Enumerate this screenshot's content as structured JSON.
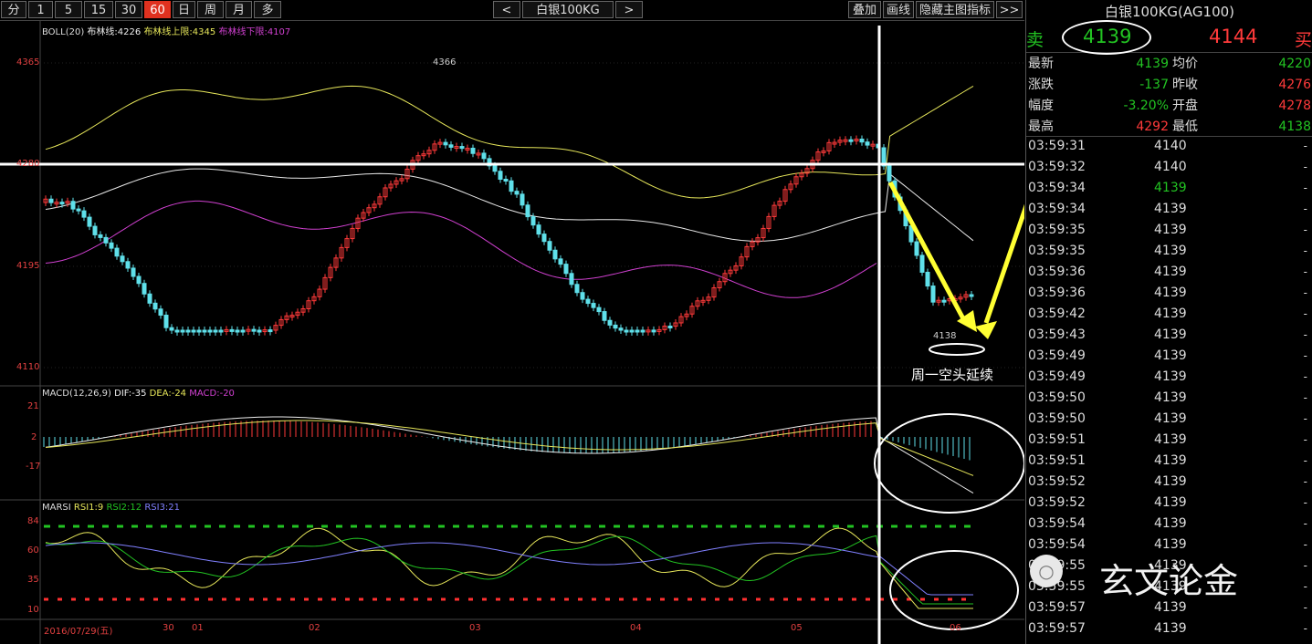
{
  "toolbar": {
    "periods": [
      "分",
      "1",
      "5",
      "15",
      "30",
      "60",
      "日",
      "周",
      "月",
      "多"
    ],
    "active_period": "60",
    "prev_label": "<",
    "next_label": ">",
    "symbol_label": "白银100KG",
    "overlay_label": "叠加",
    "draw_label": "画线",
    "hide_indicator_label": "隐藏主图指标",
    "expand_label": ">>"
  },
  "main_chart": {
    "boll_title": "BOLL(20)",
    "mid_label": "布林线:4226",
    "upper_label": "布林线上限:4345",
    "lower_label": "布林线下限:4107",
    "y_ticks": [
      "4365",
      "4280",
      "4195",
      "4110"
    ],
    "high_mark": "4366",
    "low_mark": "4138",
    "annotation": "周一空头延续"
  },
  "macd": {
    "title": "MACD(12,26,9)",
    "dif": "DIF:-35",
    "dea": "DEA:-24",
    "macd": "MACD:-20",
    "y_ticks": [
      "21",
      "2",
      "-17"
    ]
  },
  "rsi": {
    "title": "MARSI",
    "rsi1": "RSI1:9",
    "rsi2": "RSI2:12",
    "rsi3": "RSI3:21",
    "y_ticks": [
      "84",
      "60",
      "35",
      "10"
    ]
  },
  "x_axis": {
    "start_date": "2016/07/29(五)",
    "labels": [
      "30",
      "01",
      "02",
      "03",
      "04",
      "05",
      "06"
    ]
  },
  "panel": {
    "title": "白银100KG(AG100)",
    "sell_label": "卖",
    "sell_price": "4139",
    "buy_price": "4144",
    "buy_label": "买",
    "stats": [
      {
        "l1": "最新",
        "v1": "4139",
        "c1": "gr",
        "l2": "均价",
        "v2": "4220",
        "c2": "gr"
      },
      {
        "l1": "涨跌",
        "v1": "-137",
        "c1": "gr",
        "l2": "昨收",
        "v2": "4276",
        "c2": "rd"
      },
      {
        "l1": "幅度",
        "v1": "-3.20%",
        "c1": "gr",
        "l2": "开盘",
        "v2": "4278",
        "c2": "rd"
      },
      {
        "l1": "最高",
        "v1": "4292",
        "c1": "rd",
        "l2": "最低",
        "v2": "4138",
        "c2": "gr"
      }
    ],
    "ticks": [
      {
        "time": "03:59:31",
        "price": "4140",
        "c": "wh"
      },
      {
        "time": "03:59:32",
        "price": "4140",
        "c": "wh"
      },
      {
        "time": "03:59:34",
        "price": "4139",
        "c": "gr"
      },
      {
        "time": "03:59:34",
        "price": "4139",
        "c": "wh"
      },
      {
        "time": "03:59:35",
        "price": "4139",
        "c": "wh"
      },
      {
        "time": "03:59:35",
        "price": "4139",
        "c": "wh"
      },
      {
        "time": "03:59:36",
        "price": "4139",
        "c": "wh"
      },
      {
        "time": "03:59:36",
        "price": "4139",
        "c": "wh"
      },
      {
        "time": "03:59:42",
        "price": "4139",
        "c": "wh"
      },
      {
        "time": "03:59:43",
        "price": "4139",
        "c": "wh"
      },
      {
        "time": "03:59:49",
        "price": "4139",
        "c": "wh"
      },
      {
        "time": "03:59:49",
        "price": "4139",
        "c": "wh"
      },
      {
        "time": "03:59:50",
        "price": "4139",
        "c": "wh"
      },
      {
        "time": "03:59:50",
        "price": "4139",
        "c": "wh"
      },
      {
        "time": "03:59:51",
        "price": "4139",
        "c": "wh"
      },
      {
        "time": "03:59:51",
        "price": "4139",
        "c": "wh"
      },
      {
        "time": "03:59:52",
        "price": "4139",
        "c": "wh"
      },
      {
        "time": "03:59:52",
        "price": "4139",
        "c": "wh"
      },
      {
        "time": "03:59:54",
        "price": "4139",
        "c": "wh"
      },
      {
        "time": "03:59:54",
        "price": "4139",
        "c": "wh"
      },
      {
        "time": "03:59:55",
        "price": "4139",
        "c": "wh"
      },
      {
        "time": "03:59:55",
        "price": "4139",
        "c": "wh"
      },
      {
        "time": "03:59:57",
        "price": "4139",
        "c": "wh"
      },
      {
        "time": "03:59:57",
        "price": "4139",
        "c": "wh"
      }
    ],
    "watermark": "玄文论金"
  },
  "colors": {
    "up": "#ff3a3a",
    "down": "#5fe0ea",
    "mid_band": "#e8e8e8",
    "upper_band": "#e6e65a",
    "lower_band": "#d040d0",
    "annotation": "#ffff33"
  }
}
